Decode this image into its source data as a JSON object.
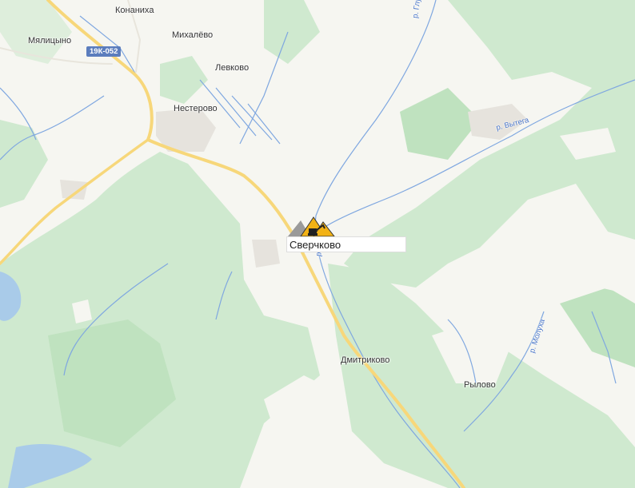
{
  "map": {
    "colors": {
      "forest": "#cfe9cf",
      "field": "#f6f6f1",
      "water": "#a9cbe9",
      "river": "#7fa7e0",
      "road": "#f7d77a",
      "settlement": "#e6e3dd"
    }
  },
  "settlements": [
    {
      "id": "konanikha",
      "name": "Конаниха"
    },
    {
      "id": "myalitsyno",
      "name": "Мялицыно"
    },
    {
      "id": "mikhalevo",
      "name": "Михалёво"
    },
    {
      "id": "levkovo",
      "name": "Левково"
    },
    {
      "id": "nesterovo",
      "name": "Нестерово"
    },
    {
      "id": "dmitrikovo",
      "name": "Дмитриково"
    },
    {
      "id": "rylovo",
      "name": "Рылово"
    }
  ],
  "road_badge": "19К-052",
  "rivers": [
    {
      "id": "glushitsa",
      "name": "р. Глушица"
    },
    {
      "id": "vytega",
      "name": "р. Вытега"
    },
    {
      "id": "molukha",
      "name": "р. Молуха"
    },
    {
      "id": "small",
      "name": "р."
    }
  ],
  "selected_place": {
    "name": "Сверчково",
    "marker_icon": "excavator-icon"
  }
}
